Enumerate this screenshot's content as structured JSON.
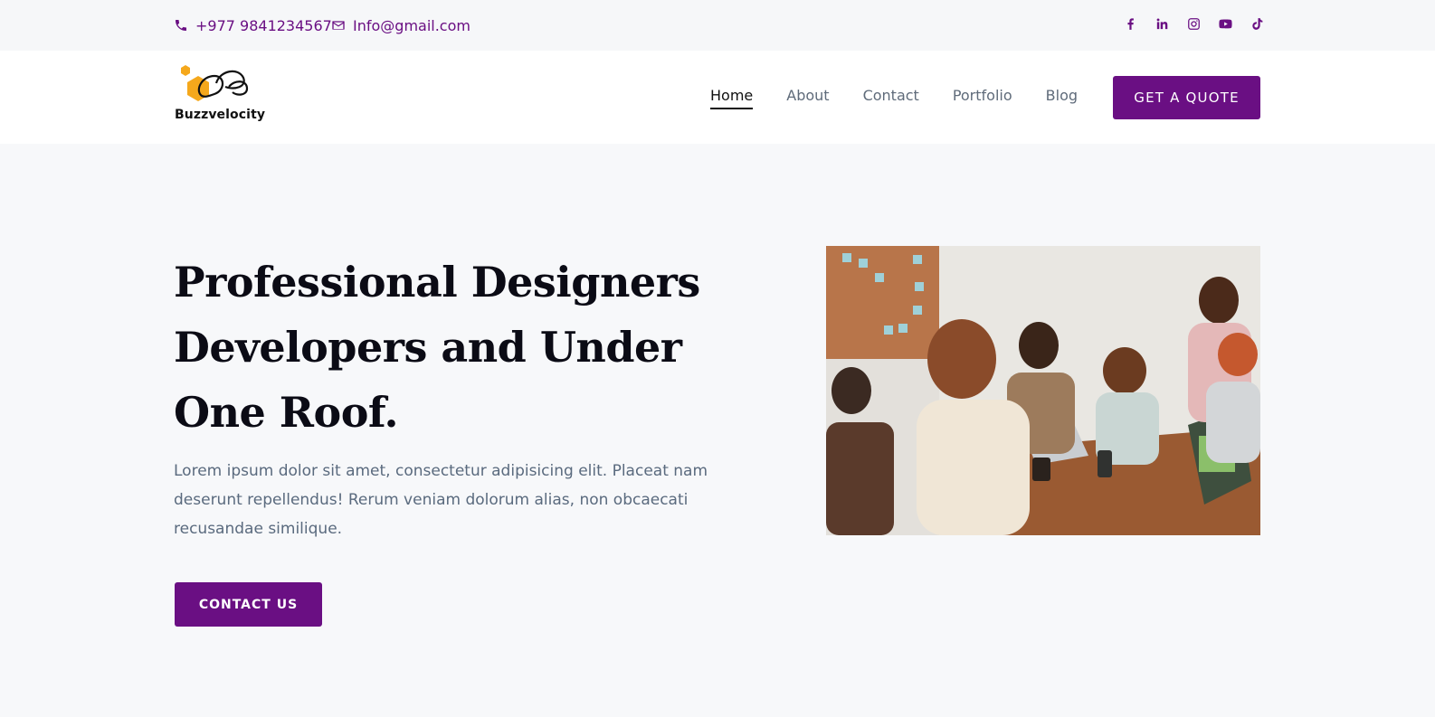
{
  "topbar": {
    "phone": "+977 9841234567",
    "email": "Info@gmail.com",
    "socials": [
      "facebook-icon",
      "linkedin-icon",
      "instagram-icon",
      "youtube-icon",
      "tiktok-icon"
    ]
  },
  "brand": {
    "name": "Buzzvelocity"
  },
  "nav": {
    "items": [
      {
        "label": "Home",
        "active": true
      },
      {
        "label": "About"
      },
      {
        "label": "Contact"
      },
      {
        "label": "Portfolio"
      },
      {
        "label": "Blog"
      }
    ],
    "cta_label": "GET A QUOTE"
  },
  "hero": {
    "title": "Professional Designers Developers and Under One Roof.",
    "description": "Lorem ipsum dolor sit amet, consectetur adipisicing elit. Placeat nam deserunt repellendus! Rerum veniam dolorum alias, non obcaecati recusandae similique.",
    "cta_label": "CONTACT US",
    "image_icon": "team-meeting-photo"
  },
  "colors": {
    "primary": "#6a0f83",
    "logo_accent": "#f5a81c",
    "text_dark": "#0b0b15",
    "text_muted": "#5a6a7e"
  }
}
